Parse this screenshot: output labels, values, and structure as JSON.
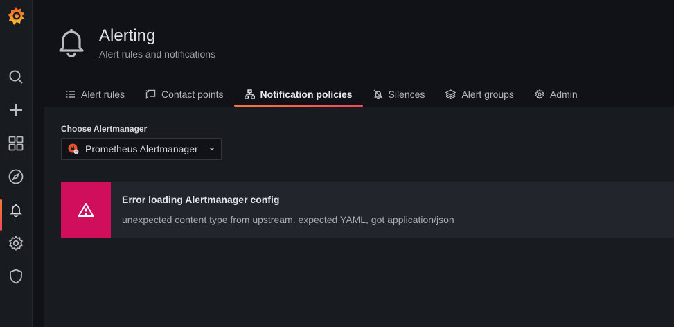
{
  "sidebar": {
    "items": [
      {
        "icon": "search-icon",
        "label": "Search"
      },
      {
        "icon": "plus-icon",
        "label": "Create"
      },
      {
        "icon": "apps-icon",
        "label": "Dashboards"
      },
      {
        "icon": "compass-icon",
        "label": "Explore"
      },
      {
        "icon": "bell-icon",
        "label": "Alerting",
        "active": true
      },
      {
        "icon": "gear-icon",
        "label": "Configuration"
      },
      {
        "icon": "shield-icon",
        "label": "Server Admin"
      }
    ]
  },
  "header": {
    "icon": "bell-icon",
    "title": "Alerting",
    "subtitle": "Alert rules and notifications"
  },
  "tabs": [
    {
      "label": "Alert rules",
      "icon": "list-icon"
    },
    {
      "label": "Contact points",
      "icon": "comment-alt-share-icon"
    },
    {
      "label": "Notification policies",
      "icon": "sitemap-icon",
      "active": true
    },
    {
      "label": "Silences",
      "icon": "bell-slash-icon"
    },
    {
      "label": "Alert groups",
      "icon": "layer-group-icon"
    },
    {
      "label": "Admin",
      "icon": "cog-icon"
    }
  ],
  "alertmanager": {
    "label": "Choose Alertmanager",
    "selected": "Prometheus Alertmanager"
  },
  "error": {
    "title": "Error loading Alertmanager config",
    "message": "unexpected content type from upstream. expected YAML, got application/json"
  },
  "colors": {
    "accent": "#f5793a",
    "error": "#d10e5c",
    "background": "#111217",
    "panel": "#181b1f"
  }
}
